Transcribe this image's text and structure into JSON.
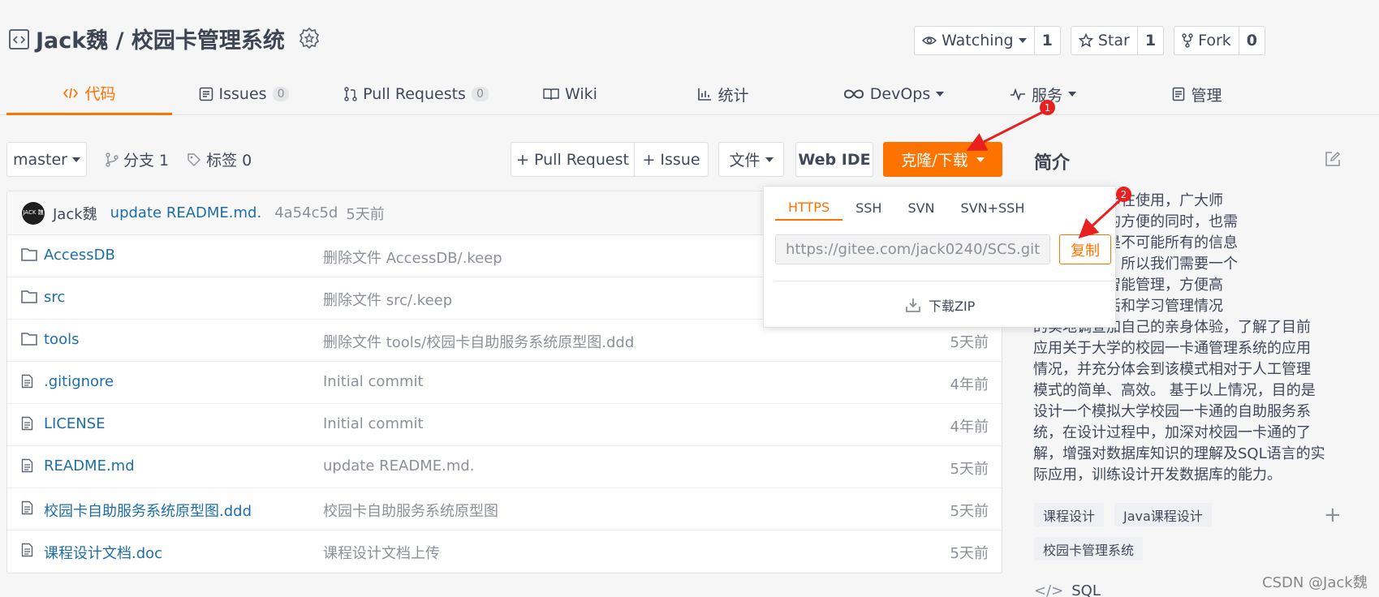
{
  "colors": {
    "accent": "#fe7300",
    "link": "#1d6ea8",
    "annotation": "#e8201f"
  },
  "header": {
    "repo_title": "Jack魏 / 校园卡管理系统",
    "watch": {
      "label": "Watching",
      "count": "1"
    },
    "star": {
      "label": "Star",
      "count": "1"
    },
    "fork": {
      "label": "Fork",
      "count": "0"
    }
  },
  "tabs": [
    {
      "label": "代码",
      "icon": "code-icon"
    },
    {
      "label": "Issues",
      "count": "0",
      "icon": "issues-icon"
    },
    {
      "label": "Pull Requests",
      "count": "0",
      "icon": "pull-request-icon"
    },
    {
      "label": "Wiki",
      "icon": "wiki-icon"
    },
    {
      "label": "统计",
      "icon": "chart-icon"
    },
    {
      "label": "DevOps",
      "icon": "infinity-icon"
    },
    {
      "label": "服务",
      "icon": "pulse-icon"
    },
    {
      "label": "管理",
      "icon": "manage-icon"
    }
  ],
  "toolbar": {
    "branch": "master",
    "branches": "分支 1",
    "tags": "标签 0",
    "pull_request": "+ Pull Request",
    "issue": "+ Issue",
    "file": "文件",
    "web_ide": "Web IDE",
    "clone": "克隆/下载"
  },
  "commit": {
    "avatar_text": "JACK 魏",
    "author": "Jack魏",
    "message": "update README.md.",
    "hash": "4a54c5d",
    "time": "5天前"
  },
  "files": [
    {
      "name": "AccessDB",
      "type": "folder",
      "message": "删除文件 AccessDB/.keep",
      "time": ""
    },
    {
      "name": "src",
      "type": "folder",
      "message": "删除文件 src/.keep",
      "time": ""
    },
    {
      "name": "tools",
      "type": "folder",
      "message": "删除文件 tools/校园卡自助服务系统原型图.ddd",
      "time": "5天前"
    },
    {
      "name": ".gitignore",
      "type": "file",
      "message": "Initial commit",
      "time": "4年前"
    },
    {
      "name": "LICENSE",
      "type": "file",
      "message": "Initial commit",
      "time": "4年前"
    },
    {
      "name": "README.md",
      "type": "file",
      "message": "update README.md.",
      "time": "5天前"
    },
    {
      "name": "校园卡自助服务系统原型图.ddd",
      "type": "file",
      "message": "校园卡自助服务系统原型图",
      "time": "5天前"
    },
    {
      "name": "课程设计文档.doc",
      "type": "file",
      "message": "课程设计文档上传",
      "time": "5天前"
    }
  ],
  "sidebar": {
    "title": "简介",
    "description_lines": [
      "校几乎都有卡在使用，广大师",
      "智能卡带来的方便的同时，也需",
      "加服务，但是不可能所有的信息",
      "查询去管理，所以我们需要一个",
      "服务系统，智能管理，方便高",
      "学生日常生活和学习管理情况",
      "的实地调查加自己的亲身体验，了解了目前",
      "应用关于大学的校园一卡通管理系统的应用",
      "情况，并充分体会到该模式相对于人工管理",
      "模式的简单、高效。 基于以上情况，目的是",
      "设计一个模拟大学校园一卡通的自助服务系",
      "统，在设计过程中，加深对校园一卡通的了",
      "解，增强对数据库知识的理解及SQL语言的实",
      "际应用，训练设计开发数据库的能力。"
    ],
    "tags": [
      "课程设计",
      "Java课程设计",
      "校园卡管理系统"
    ],
    "language": "SQL"
  },
  "clone_popup": {
    "tabs": [
      "HTTPS",
      "SSH",
      "SVN",
      "SVN+SSH"
    ],
    "url": "https://gitee.com/jack0240/SCS.git",
    "copy": "复制",
    "download_zip": "下载ZIP"
  },
  "annotations": {
    "marker1": "1",
    "marker2": "2"
  },
  "watermark": "CSDN @Jack魏"
}
